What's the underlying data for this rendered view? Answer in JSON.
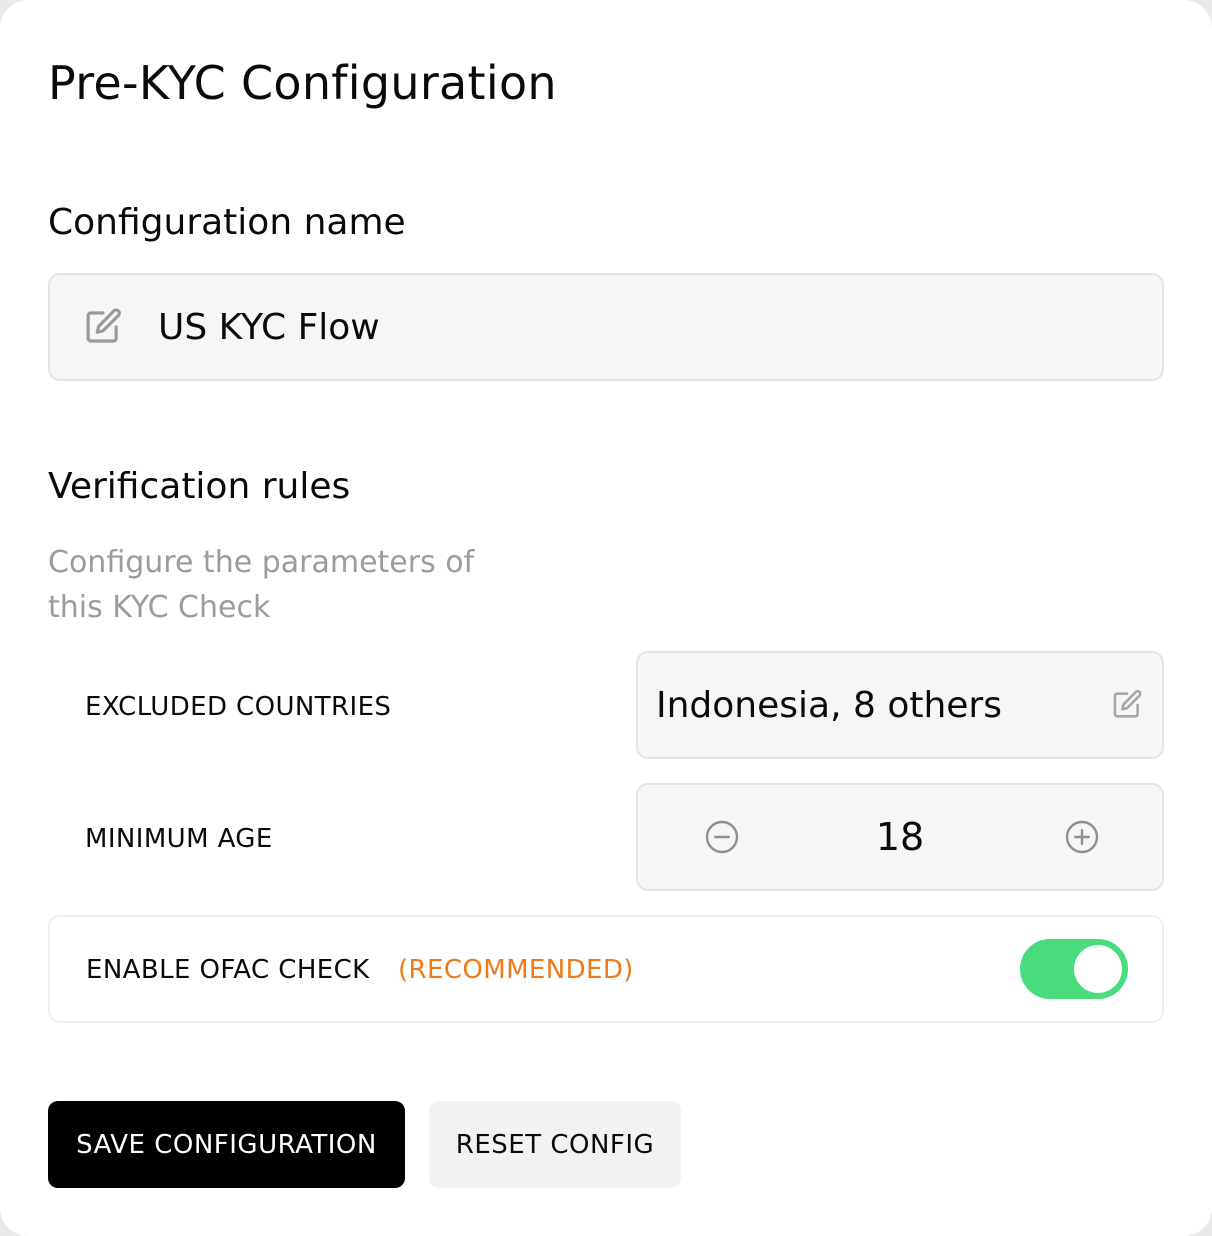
{
  "page": {
    "title": "Pre-KYC Configuration"
  },
  "configuration_name": {
    "heading": "Configuration name",
    "value": "US KYC Flow",
    "icon": "edit-icon"
  },
  "verification_rules": {
    "heading": "Verification rules",
    "description": "Configure the parameters of this KYC Check",
    "excluded_countries": {
      "label": "EXCLUDED COUNTRIES",
      "value": "Indonesia, 8 others",
      "icon": "edit-icon"
    },
    "minimum_age": {
      "label": "MINIMUM AGE",
      "value": "18",
      "decrement_icon": "minus-circle-icon",
      "increment_icon": "plus-circle-icon"
    },
    "ofac_check": {
      "label": "ENABLE OFAC CHECK",
      "badge": "(RECOMMENDED)",
      "enabled": true
    }
  },
  "actions": {
    "save_label": "SAVE CONFIGURATION",
    "reset_label": "RESET CONFIG"
  },
  "colors": {
    "accent_orange": "#f07a1a",
    "toggle_on": "#48dc7d",
    "primary_button": "#000000",
    "muted_text": "#9c9c9c"
  }
}
